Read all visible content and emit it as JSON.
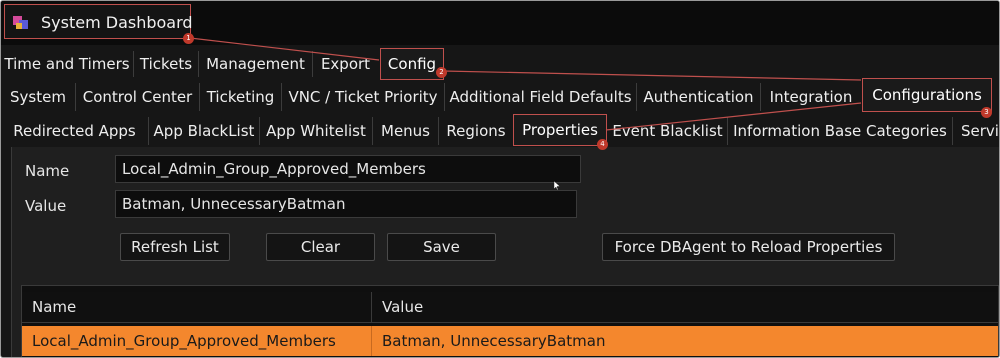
{
  "window": {
    "title": "System Dashboard",
    "icon": "app-icon"
  },
  "tabs_level1": [
    "Time and Timers",
    "Tickets",
    "Management",
    "Export",
    "Config"
  ],
  "tabs_level2": [
    "System",
    "Control Center",
    "Ticketing",
    "VNC / Ticket Priority",
    "Additional Field Defaults",
    "Authentication",
    "Integration",
    "Configurations"
  ],
  "tabs_level3": [
    "Redirected Apps",
    "App BlackList",
    "App Whitelist",
    "Menus",
    "Regions",
    "Properties",
    "Event Blacklist",
    "Information Base Categories",
    "Servi"
  ],
  "active": {
    "level1": "Config",
    "level2": "Configurations",
    "level3": "Properties"
  },
  "form": {
    "name_label": "Name",
    "name_value": "Local_Admin_Group_Approved_Members",
    "value_label": "Value",
    "value_value": "Batman, UnnecessaryBatman"
  },
  "buttons": {
    "refresh": "Refresh List",
    "clear": "Clear",
    "save": "Save",
    "force_reload": "Force DBAgent to Reload Properties"
  },
  "table": {
    "columns": [
      "Name",
      "Value"
    ],
    "rows": [
      {
        "name": "Local_Admin_Group_Approved_Members",
        "value": "Batman, UnnecessaryBatman",
        "selected": true
      }
    ]
  },
  "annotations": [
    "1",
    "2",
    "3",
    "4"
  ],
  "colors": {
    "annotation": "#c0504d",
    "selected_row": "#f4872d",
    "background": "#161616"
  }
}
